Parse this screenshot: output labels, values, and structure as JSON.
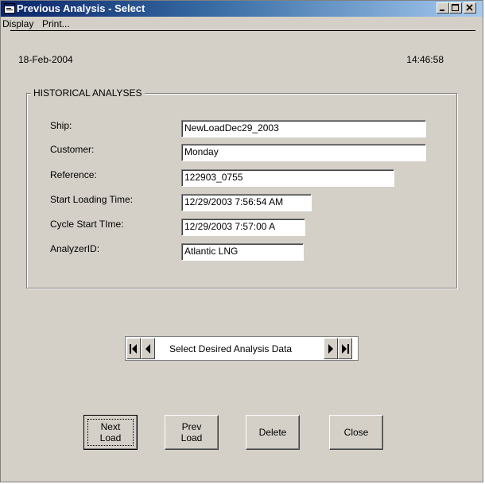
{
  "window": {
    "title": "Previous Analysis - Select",
    "icon": "app-window-icon",
    "controls": [
      "minimize-icon",
      "maximize-icon",
      "close-icon"
    ]
  },
  "menu": {
    "items": [
      "Display",
      "Print..."
    ]
  },
  "header": {
    "date": "18-Feb-2004",
    "time": "14:46:58"
  },
  "group": {
    "title": "HISTORICAL ANALYSES",
    "fields": [
      {
        "label": "Ship:",
        "value": "NewLoadDec29_2003"
      },
      {
        "label": "Customer:",
        "value": "Monday"
      },
      {
        "label": "Reference:",
        "value": "122903_0755"
      },
      {
        "label": "Start Loading Time:",
        "value": "12/29/2003 7:56:54 AM"
      },
      {
        "label": "Cycle Start TIme:",
        "value": "12/29/2003 7:57:00 A"
      },
      {
        "label": "AnalyzerID:",
        "value": "Atlantic LNG"
      }
    ]
  },
  "navigator": {
    "label": "Select Desired Analysis Data",
    "icons": [
      "first-record-icon",
      "previous-record-icon",
      "next-record-icon",
      "last-record-icon"
    ]
  },
  "buttons": {
    "next_load": "Next\nLoad",
    "prev_load": "Prev\nLoad",
    "delete": "Delete",
    "close": "Close"
  }
}
